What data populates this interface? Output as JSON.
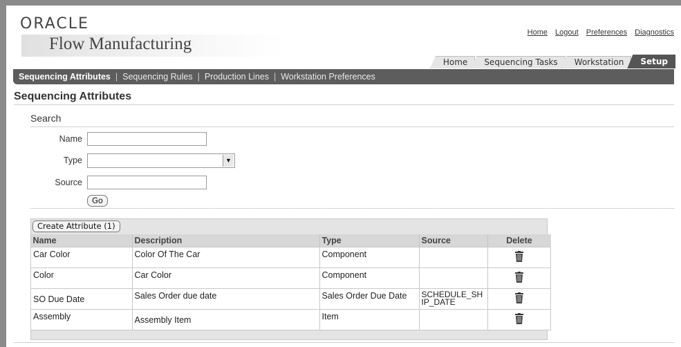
{
  "branding": {
    "logo": "ORACLE",
    "product": "Flow Manufacturing"
  },
  "global_links": [
    "Home",
    "Logout",
    "Preferences",
    "Diagnostics"
  ],
  "tabs": [
    {
      "label": "Home",
      "active": false
    },
    {
      "label": "Sequencing Tasks",
      "active": false
    },
    {
      "label": "Workstation",
      "active": false
    },
    {
      "label": "Setup",
      "active": true
    }
  ],
  "subnav": [
    {
      "label": "Sequencing Attributes",
      "selected": true
    },
    {
      "label": "Sequencing Rules",
      "selected": false
    },
    {
      "label": "Production Lines",
      "selected": false
    },
    {
      "label": "Workstation Preferences",
      "selected": false
    }
  ],
  "page_title": "Sequencing Attributes",
  "search": {
    "title": "Search",
    "name_label": "Name",
    "name_value": "",
    "type_label": "Type",
    "type_value": "",
    "source_label": "Source",
    "source_value": "",
    "go_label": "Go"
  },
  "results": {
    "create_button": "Create Attribute (1)",
    "columns": [
      "Name",
      "Description",
      "Type",
      "Source",
      "Delete"
    ],
    "rows": [
      {
        "name": "Car Color",
        "description": "Color Of The Car",
        "type": "Component",
        "source": ""
      },
      {
        "name": "Color",
        "description": "Car Color",
        "type": "Component",
        "source": ""
      },
      {
        "name": "SO Due Date",
        "description": "Sales Order due date",
        "type": "Sales Order Due Date",
        "source": "SCHEDULE_SHIP_DATE"
      },
      {
        "name": "Assembly",
        "description": "Assembly Item",
        "type": "Item",
        "source": ""
      }
    ],
    "delete_icon": "trash-icon"
  }
}
